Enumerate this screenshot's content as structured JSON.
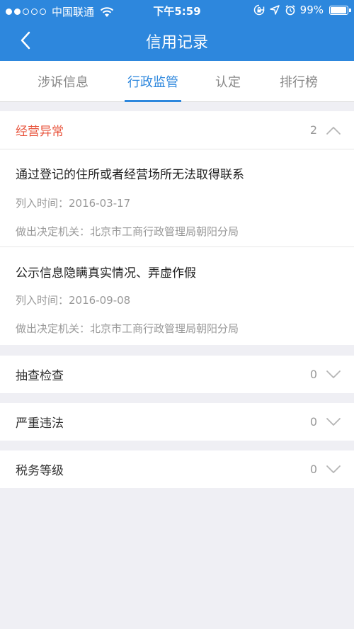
{
  "status_bar": {
    "carrier": "中国联通",
    "time": "下午5:59",
    "battery": "99%",
    "battery_level": 0.99,
    "icons": [
      "wifi-icon",
      "lock-rotation-icon",
      "location-icon",
      "alarm-icon",
      "battery-icon"
    ]
  },
  "nav": {
    "title": "信用记录",
    "back_icon": "chevron-left-icon"
  },
  "tabs": [
    {
      "label": "涉诉信息",
      "active": false
    },
    {
      "label": "行政监管",
      "active": true
    },
    {
      "label": "认定",
      "active": false
    },
    {
      "label": "排行榜",
      "active": false
    }
  ],
  "sections": [
    {
      "title": "经营异常",
      "count": "2",
      "expanded": true,
      "records": [
        {
          "title": "通过登记的住所或者经营场所无法取得联系",
          "date_label": "列入时间：",
          "date": "2016-03-17",
          "authority_label": "做出决定机关：",
          "authority": "北京市工商行政管理局朝阳分局"
        },
        {
          "title": "公示信息隐瞒真实情况、弄虚作假",
          "date_label": "列入时间：",
          "date": "2016-09-08",
          "authority_label": "做出决定机关：",
          "authority": "北京市工商行政管理局朝阳分局"
        }
      ]
    },
    {
      "title": "抽查检查",
      "count": "0",
      "expanded": false
    },
    {
      "title": "严重违法",
      "count": "0",
      "expanded": false
    },
    {
      "title": "税务等级",
      "count": "0",
      "expanded": false
    }
  ],
  "colors": {
    "primary": "#2d87dd",
    "danger": "#e8553d",
    "background": "#efeff4"
  }
}
